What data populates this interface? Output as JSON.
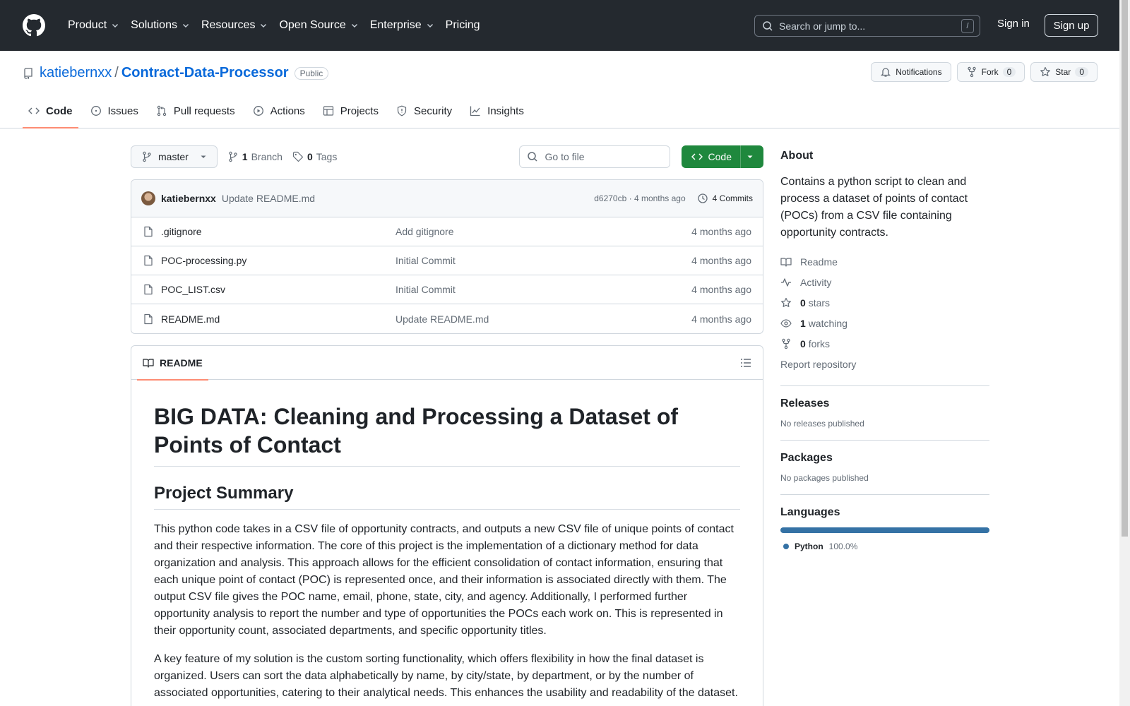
{
  "header": {
    "nav": [
      "Product",
      "Solutions",
      "Resources",
      "Open Source",
      "Enterprise",
      "Pricing"
    ],
    "search_placeholder": "Search or jump to...",
    "search_shortcut": "/",
    "signin": "Sign in",
    "signup": "Sign up"
  },
  "repo": {
    "owner": "katiebernxx",
    "separator": "/",
    "name": "Contract-Data-Processor",
    "visibility": "Public",
    "notifications": "Notifications",
    "fork_label": "Fork",
    "fork_count": "0",
    "star_label": "Star",
    "star_count": "0",
    "tabs": [
      "Code",
      "Issues",
      "Pull requests",
      "Actions",
      "Projects",
      "Security",
      "Insights"
    ]
  },
  "toolbar": {
    "branch": "master",
    "branch_count": "1",
    "branch_label": "Branch",
    "tag_count": "0",
    "tag_label": "Tags",
    "goto_placeholder": "Go to file",
    "code_button": "Code"
  },
  "commit": {
    "user": "katiebernxx",
    "message": "Update README.md",
    "meta": "d6270cb · 4 months ago",
    "commits": "4 Commits"
  },
  "files": [
    {
      "name": ".gitignore",
      "commit": "Add gitignore",
      "date": "4 months ago"
    },
    {
      "name": "POC-processing.py",
      "commit": "Initial Commit",
      "date": "4 months ago"
    },
    {
      "name": "POC_LIST.csv",
      "commit": "Initial Commit",
      "date": "4 months ago"
    },
    {
      "name": "README.md",
      "commit": "Update README.md",
      "date": "4 months ago"
    }
  ],
  "readme": {
    "tab": "README",
    "h1": "BIG DATA: Cleaning and Processing a Dataset of Points of Contact",
    "h2": "Project Summary",
    "p1": "This python code takes in a CSV file of opportunity contracts, and outputs a new CSV file of unique points of contact and their respective information. The core of this project is the implementation of a dictionary method for data organization and analysis. This approach allows for the efficient consolidation of contact information, ensuring that each unique point of contact (POC) is represented once, and their information is associated directly with them. The output CSV file gives the POC name, email, phone, state, city, and agency. Additionally, I performed further opportunity analysis to report the number and type of opportunities the POCs each work on. This is represented in their opportunity count, associated departments, and specific opportunity titles.",
    "p2": "A key feature of my solution is the custom sorting functionality, which offers flexibility in how the final dataset is organized. Users can sort the data alphabetically by name, by city/state, by department, or by the number of associated opportunities, catering to their analytical needs. This enhances the usability and readability of the dataset."
  },
  "about": {
    "title": "About",
    "description": "Contains a python script to clean and process a dataset of points of contact (POCs) from a CSV file containing opportunity contracts.",
    "readme": "Readme",
    "activity": "Activity",
    "stars_count": "0",
    "stars_label": "stars",
    "watching_count": "1",
    "watching_label": "watching",
    "forks_count": "0",
    "forks_label": "forks",
    "report": "Report repository"
  },
  "releases": {
    "title": "Releases",
    "text": "No releases published"
  },
  "packages": {
    "title": "Packages",
    "text": "No packages published"
  },
  "languages": {
    "title": "Languages",
    "name": "Python",
    "percent": "100.0%",
    "color": "#3572A5"
  }
}
